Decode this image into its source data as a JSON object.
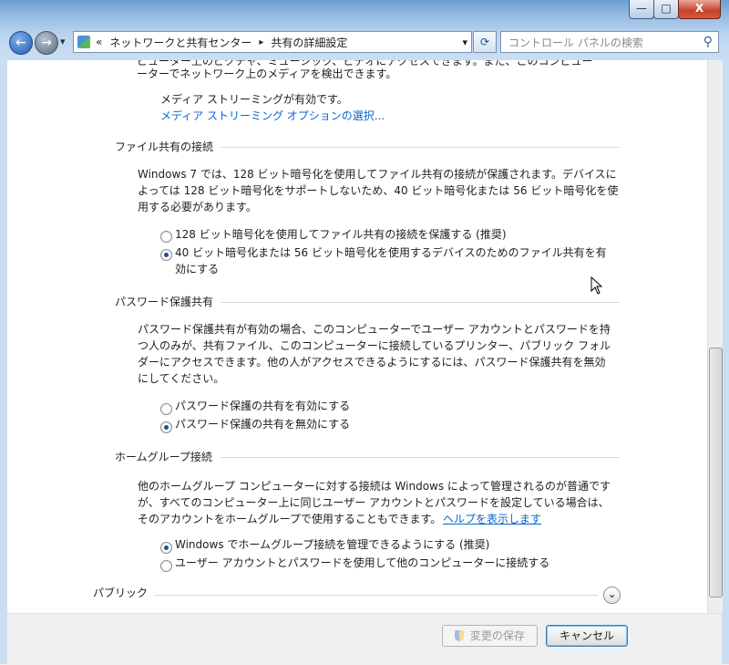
{
  "window": {
    "controls": {
      "minimize_glyph": "—",
      "maximize_glyph": "□",
      "close_glyph": "X"
    }
  },
  "nav": {
    "back_glyph": "←",
    "forward_glyph": "→",
    "dropdown_glyph": "▾",
    "refresh_glyph": "⟳",
    "search_glyph": "⚲",
    "address": {
      "overflow": "«",
      "crumb1": "ネットワークと共有センター",
      "sep": "▸",
      "crumb2": "共有の詳細設定"
    },
    "search_placeholder": "コントロール パネルの検索"
  },
  "content": {
    "top_partial_line1": "ピューター上のピクチャ、ミュージック、ビデオにアクセスできます。また、このコンピュー",
    "top_partial_line2": "ーターでネットワーク上のメディアを検出できます。",
    "media_status": "メディア ストリーミングが有効です。",
    "media_link": "メディア ストリーミング オプションの選択...",
    "file_sharing": {
      "heading": "ファイル共有の接続",
      "desc": [
        "Windows 7 では、128 ビット暗号化を使用してファイル共有の接続が保護されます。デバイスに",
        "よっては 128 ビット暗号化をサポートしないため、40 ビット暗号化または 56 ビット暗号化を使",
        "用する必要があります。"
      ],
      "option1": "128 ビット暗号化を使用してファイル共有の接続を保護する (推奨)",
      "option2_line1": "40 ビット暗号化または 56 ビット暗号化を使用するデバイスのためのファイル共有を有",
      "option2_line2": "効にする"
    },
    "password": {
      "heading": "パスワード保護共有",
      "desc": [
        "パスワード保護共有が有効の場合、このコンピューターでユーザー アカウントとパスワードを持",
        "つ人のみが、共有ファイル、このコンピューターに接続しているプリンター、パブリック フォル",
        "ダーにアクセスできます。他の人がアクセスできるようにするには、パスワード保護共有を無効",
        "にしてください。"
      ],
      "option1": "パスワード保護の共有を有効にする",
      "option2": "パスワード保護の共有を無効にする"
    },
    "homegroup": {
      "heading": "ホームグループ接続",
      "desc": [
        "他のホームグループ コンピューターに対する接続は Windows によって管理されるのが普通です",
        "が、すべてのコンピューター上に同じユーザー アカウントとパスワードを設定している場合は、",
        "そのアカウントをホームグループで使用することもできます。"
      ],
      "help_link": "ヘルプを表示します",
      "option1": "Windows でホームグループ接続を管理できるようにする (推奨)",
      "option2": "ユーザー アカウントとパスワードを使用して他のコンピューターに接続する"
    },
    "public": {
      "heading": "パブリック",
      "expand_glyph": "⌄"
    }
  },
  "footer": {
    "save_label": "変更の保存",
    "cancel_label": "キャンセル"
  },
  "colors": {
    "link": "#0a66cc",
    "radio_selected": "#1d4e9c",
    "frame": "#c9def2"
  }
}
